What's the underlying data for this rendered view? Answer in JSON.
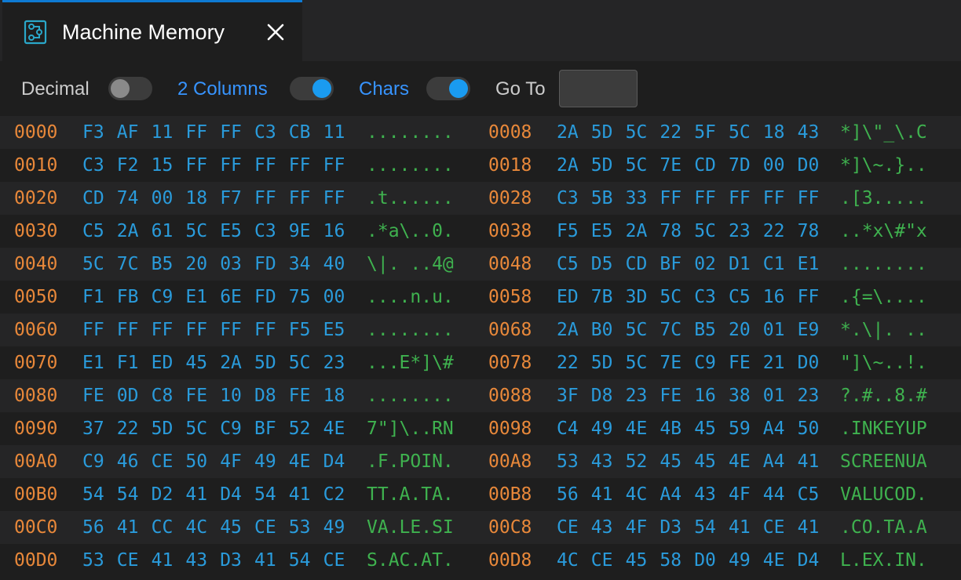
{
  "tab": {
    "title": "Machine Memory",
    "icon": "memory-chip-icon",
    "close_icon": "close-icon"
  },
  "toolbar": {
    "decimal_label": "Decimal",
    "decimal_on": false,
    "columns_label": "2 Columns",
    "columns_on": true,
    "chars_label": "Chars",
    "chars_on": true,
    "goto_label": "Go To",
    "goto_value": ""
  },
  "colors": {
    "address": "#e8883a",
    "hex": "#2a9bdb",
    "chars": "#3fb24f",
    "accent": "#0e7ad3"
  },
  "rows": [
    {
      "addr1": "0000",
      "bytes1": [
        "F3",
        "AF",
        "11",
        "FF",
        "FF",
        "C3",
        "CB",
        "11"
      ],
      "chars1": "........",
      "addr2": "0008",
      "bytes2": [
        "2A",
        "5D",
        "5C",
        "22",
        "5F",
        "5C",
        "18",
        "43"
      ],
      "chars2": "*]\\\"_\\.C"
    },
    {
      "addr1": "0010",
      "bytes1": [
        "C3",
        "F2",
        "15",
        "FF",
        "FF",
        "FF",
        "FF",
        "FF"
      ],
      "chars1": "........",
      "addr2": "0018",
      "bytes2": [
        "2A",
        "5D",
        "5C",
        "7E",
        "CD",
        "7D",
        "00",
        "D0"
      ],
      "chars2": "*]\\~.}.."
    },
    {
      "addr1": "0020",
      "bytes1": [
        "CD",
        "74",
        "00",
        "18",
        "F7",
        "FF",
        "FF",
        "FF"
      ],
      "chars1": ".t......",
      "addr2": "0028",
      "bytes2": [
        "C3",
        "5B",
        "33",
        "FF",
        "FF",
        "FF",
        "FF",
        "FF"
      ],
      "chars2": ".[3....."
    },
    {
      "addr1": "0030",
      "bytes1": [
        "C5",
        "2A",
        "61",
        "5C",
        "E5",
        "C3",
        "9E",
        "16"
      ],
      "chars1": ".*a\\..0.",
      "addr2": "0038",
      "bytes2": [
        "F5",
        "E5",
        "2A",
        "78",
        "5C",
        "23",
        "22",
        "78"
      ],
      "chars2": "..*x\\#\"x"
    },
    {
      "addr1": "0040",
      "bytes1": [
        "5C",
        "7C",
        "B5",
        "20",
        "03",
        "FD",
        "34",
        "40"
      ],
      "chars1": "\\|. ..4@",
      "addr2": "0048",
      "bytes2": [
        "C5",
        "D5",
        "CD",
        "BF",
        "02",
        "D1",
        "C1",
        "E1"
      ],
      "chars2": "........"
    },
    {
      "addr1": "0050",
      "bytes1": [
        "F1",
        "FB",
        "C9",
        "E1",
        "6E",
        "FD",
        "75",
        "00"
      ],
      "chars1": "....n.u.",
      "addr2": "0058",
      "bytes2": [
        "ED",
        "7B",
        "3D",
        "5C",
        "C3",
        "C5",
        "16",
        "FF"
      ],
      "chars2": ".{=\\...."
    },
    {
      "addr1": "0060",
      "bytes1": [
        "FF",
        "FF",
        "FF",
        "FF",
        "FF",
        "FF",
        "F5",
        "E5"
      ],
      "chars1": "........",
      "addr2": "0068",
      "bytes2": [
        "2A",
        "B0",
        "5C",
        "7C",
        "B5",
        "20",
        "01",
        "E9"
      ],
      "chars2": "*.\\|. .."
    },
    {
      "addr1": "0070",
      "bytes1": [
        "E1",
        "F1",
        "ED",
        "45",
        "2A",
        "5D",
        "5C",
        "23"
      ],
      "chars1": "...E*]\\#",
      "addr2": "0078",
      "bytes2": [
        "22",
        "5D",
        "5C",
        "7E",
        "C9",
        "FE",
        "21",
        "D0"
      ],
      "chars2": "\"]\\~..!."
    },
    {
      "addr1": "0080",
      "bytes1": [
        "FE",
        "0D",
        "C8",
        "FE",
        "10",
        "D8",
        "FE",
        "18"
      ],
      "chars1": "........",
      "addr2": "0088",
      "bytes2": [
        "3F",
        "D8",
        "23",
        "FE",
        "16",
        "38",
        "01",
        "23"
      ],
      "chars2": "?.#..8.#"
    },
    {
      "addr1": "0090",
      "bytes1": [
        "37",
        "22",
        "5D",
        "5C",
        "C9",
        "BF",
        "52",
        "4E"
      ],
      "chars1": "7\"]\\..RN",
      "addr2": "0098",
      "bytes2": [
        "C4",
        "49",
        "4E",
        "4B",
        "45",
        "59",
        "A4",
        "50"
      ],
      "chars2": ".INKEYUP"
    },
    {
      "addr1": "00A0",
      "bytes1": [
        "C9",
        "46",
        "CE",
        "50",
        "4F",
        "49",
        "4E",
        "D4"
      ],
      "chars1": ".F.POIN.",
      "addr2": "00A8",
      "bytes2": [
        "53",
        "43",
        "52",
        "45",
        "45",
        "4E",
        "A4",
        "41"
      ],
      "chars2": "SCREENUA"
    },
    {
      "addr1": "00B0",
      "bytes1": [
        "54",
        "54",
        "D2",
        "41",
        "D4",
        "54",
        "41",
        "C2"
      ],
      "chars1": "TT.A.TA.",
      "addr2": "00B8",
      "bytes2": [
        "56",
        "41",
        "4C",
        "A4",
        "43",
        "4F",
        "44",
        "C5"
      ],
      "chars2": "VALUCOD."
    },
    {
      "addr1": "00C0",
      "bytes1": [
        "56",
        "41",
        "CC",
        "4C",
        "45",
        "CE",
        "53",
        "49"
      ],
      "chars1": "VA.LE.SI",
      "addr2": "00C8",
      "bytes2": [
        "CE",
        "43",
        "4F",
        "D3",
        "54",
        "41",
        "CE",
        "41"
      ],
      "chars2": ".CO.TA.A"
    },
    {
      "addr1": "00D0",
      "bytes1": [
        "53",
        "CE",
        "41",
        "43",
        "D3",
        "41",
        "54",
        "CE"
      ],
      "chars1": "S.AC.AT.",
      "addr2": "00D8",
      "bytes2": [
        "4C",
        "CE",
        "45",
        "58",
        "D0",
        "49",
        "4E",
        "D4"
      ],
      "chars2": "L.EX.IN."
    }
  ]
}
